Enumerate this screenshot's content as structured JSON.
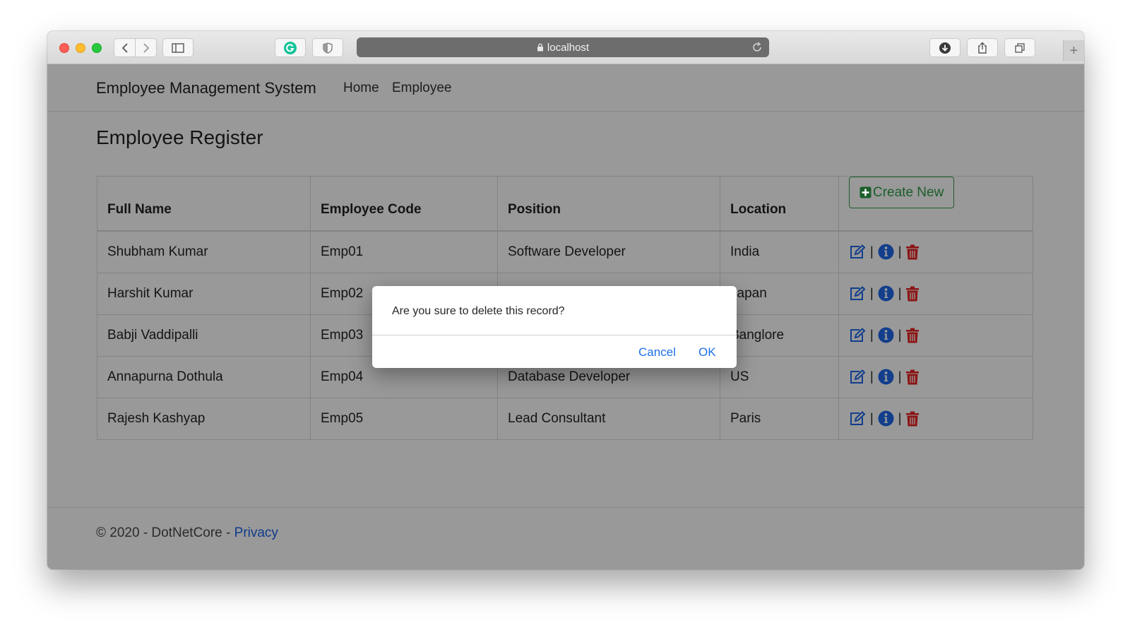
{
  "browser": {
    "url": "localhost"
  },
  "navbar": {
    "brand": "Employee Management System",
    "links": [
      "Home",
      "Employee"
    ]
  },
  "page": {
    "title": "Employee Register"
  },
  "table": {
    "headers": [
      "Full Name",
      "Employee Code",
      "Position",
      "Location"
    ],
    "create_label": "Create New",
    "rows": [
      {
        "name": "Shubham Kumar",
        "code": "Emp01",
        "position": "Software Developer",
        "location": "India"
      },
      {
        "name": "Harshit Kumar",
        "code": "Emp02",
        "position": "",
        "location": "Japan"
      },
      {
        "name": "Babji Vaddipalli",
        "code": "Emp03",
        "position": "",
        "location": "Banglore"
      },
      {
        "name": "Annapurna Dothula",
        "code": "Emp04",
        "position": "Database Developer",
        "location": "US"
      },
      {
        "name": "Rajesh Kashyap",
        "code": "Emp05",
        "position": "Lead Consultant",
        "location": "Paris"
      }
    ],
    "action_separator": "|",
    "action_icons": [
      "edit-icon",
      "info-icon",
      "trash-icon"
    ]
  },
  "footer": {
    "text": "© 2020 - DotNetCore - ",
    "link": "Privacy"
  },
  "dialog": {
    "message": "Are you sure to delete this record?",
    "cancel": "Cancel",
    "ok": "OK"
  },
  "colors": {
    "overlay_page": "#999999",
    "create_button": "#1c5e2a",
    "edit_icon": "#123e8c",
    "info_icon": "#123e8c",
    "delete_icon": "#8b1414",
    "dialog_button": "#1e6fe8"
  }
}
